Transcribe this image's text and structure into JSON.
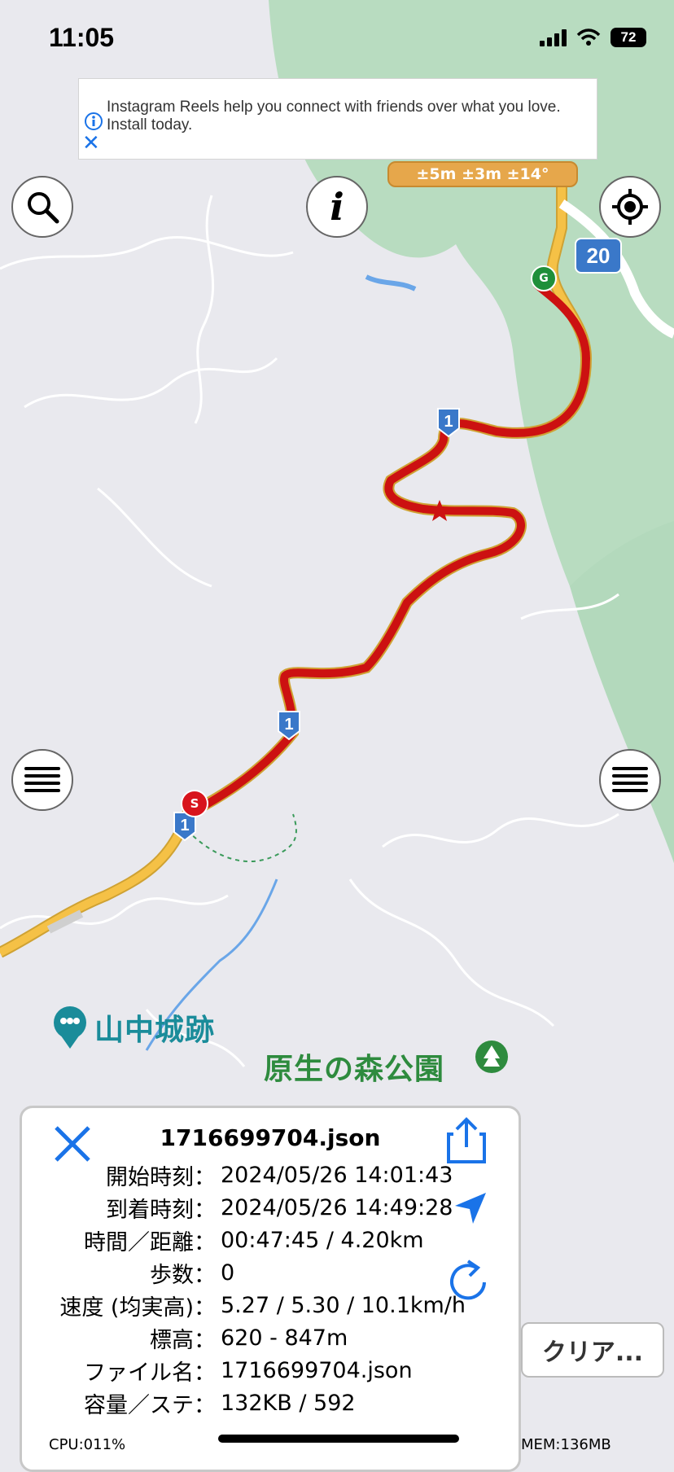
{
  "status_bar": {
    "time": "11:05",
    "battery": "72"
  },
  "ad": {
    "text": "Instagram Reels help you connect with friends over what you love. Install today."
  },
  "map": {
    "accuracy": "±5m ±3m ±14°",
    "route_number": "1",
    "route_badge_20": "20",
    "start_marker": "S",
    "goal_marker": "G",
    "places": {
      "castle": "山中城跡",
      "park": "原生の森公園"
    },
    "colors": {
      "track": "#cc1111",
      "road": "#f5c146",
      "forest": "#b8dcc0",
      "water": "#6aa6e8"
    }
  },
  "panel": {
    "title": "1716699704.json",
    "rows": [
      {
        "label": "開始時刻：",
        "value": "2024/05/26 14:01:43"
      },
      {
        "label": "到着時刻：",
        "value": "2024/05/26 14:49:28"
      },
      {
        "label": "時間／距離：",
        "value": "00:47:45 / 4.20km"
      },
      {
        "label": "歩数：",
        "value": "0"
      },
      {
        "label": "速度 (均実高)：",
        "value": "5.27 / 5.30 / 10.1km/h"
      },
      {
        "label": "標高：",
        "value": "620 - 847m"
      },
      {
        "label": "ファイル名：",
        "value": "1716699704.json"
      },
      {
        "label": "容量／ステ：",
        "value": "132KB / 592"
      }
    ],
    "icons": [
      "close-icon",
      "share-icon",
      "navigate-icon",
      "refresh-icon"
    ]
  },
  "toolbar": {
    "clear_label": "クリア..."
  },
  "footer": {
    "cpu": "CPU:011%",
    "mem": "MEM:136MB"
  }
}
